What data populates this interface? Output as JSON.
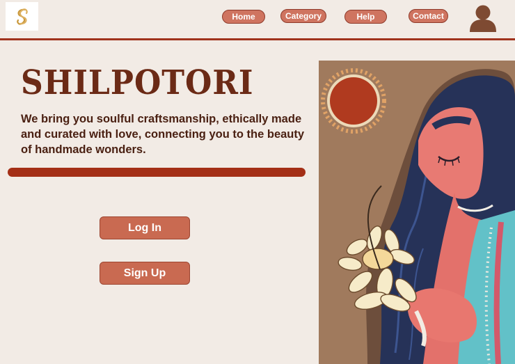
{
  "nav": {
    "home": "Home",
    "category": "Category",
    "help": "Help",
    "contact": "Contact"
  },
  "hero": {
    "title": "SHILPOTORI",
    "tagline": " We bring you soulful craftsmanship, ethically made and curated with love, connecting you to the beauty of handmade wonders."
  },
  "actions": {
    "login": "Log In",
    "signup": "Sign Up"
  },
  "icons": {
    "logo": "brand-logo-icon",
    "avatar": "user-avatar-icon"
  },
  "colors": {
    "background": "#f2ebe5",
    "accent": "#cf7460",
    "rule": "#a0331d",
    "title": "#6b2a16"
  }
}
